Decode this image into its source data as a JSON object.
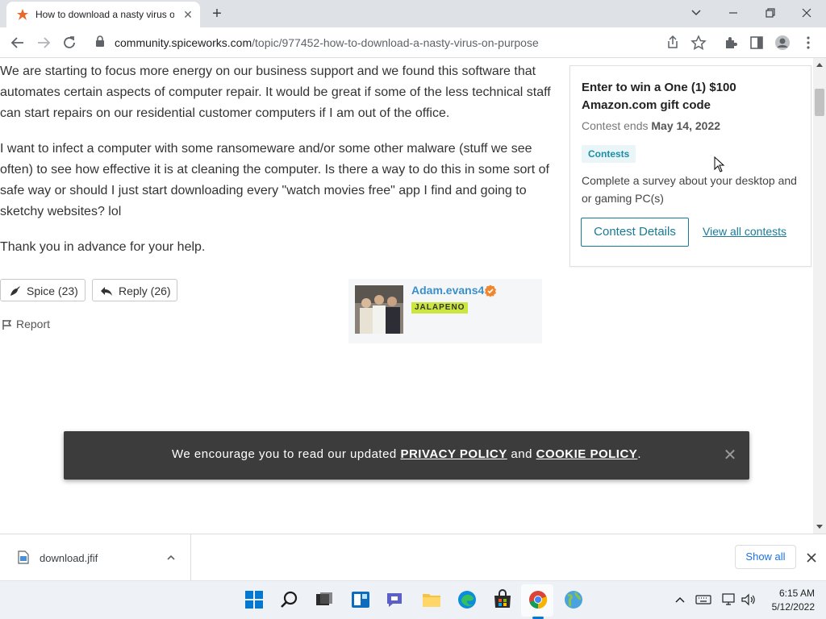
{
  "browser": {
    "tab_title": "How to download a nasty virus on purpose",
    "url_host": "community.spiceworks.com",
    "url_path": "/topic/977452-how-to-download-a-nasty-virus-on-purpose"
  },
  "post": {
    "paragraph1": "We are starting to focus more energy on our business support and we found this software that automates certain aspects of computer repair. It would be great if some of the less technical staff can start repairs on our residential customer computers if I am out of the office.",
    "paragraph2": " I want to infect a computer with some ransomeware and/or some other malware (stuff we see often) to see how effective it is at cleaning the computer. Is there a way to do this in some sort of safe way or should I just start downloading every \"watch movies free\" app I find and going to sketchy websites? lol",
    "paragraph3": "Thank you in advance for your help.",
    "spice_label": "Spice (23)",
    "reply_label": "Reply (26)",
    "report_label": "Report"
  },
  "author": {
    "name": "Adam.evans4",
    "rank": "JALAPENO"
  },
  "contest": {
    "title": "Enter to win a One (1) $100 Amazon.com gift code",
    "ends_prefix": "Contest ends",
    "ends_date": "May 14, 2022",
    "tag": "Contests",
    "description": "Complete a survey about your desktop and or gaming PC(s)",
    "details_button": "Contest Details",
    "view_all_link": "View all contests"
  },
  "cookie_banner": {
    "text_before": "We encourage you to read our updated",
    "privacy_link": "PRIVACY POLICY",
    "text_middle": "and",
    "cookie_link": "COOKIE POLICY",
    "text_after": "."
  },
  "downloads": {
    "file_name": "download.jfif",
    "show_all": "Show all"
  },
  "taskbar": {
    "time": "6:15 AM",
    "date": "5/12/2022"
  },
  "colors": {
    "link": "#1a7a95",
    "author": "#3a8fcb",
    "badge": "#cbe63e",
    "banner": "#3c3c3c"
  }
}
